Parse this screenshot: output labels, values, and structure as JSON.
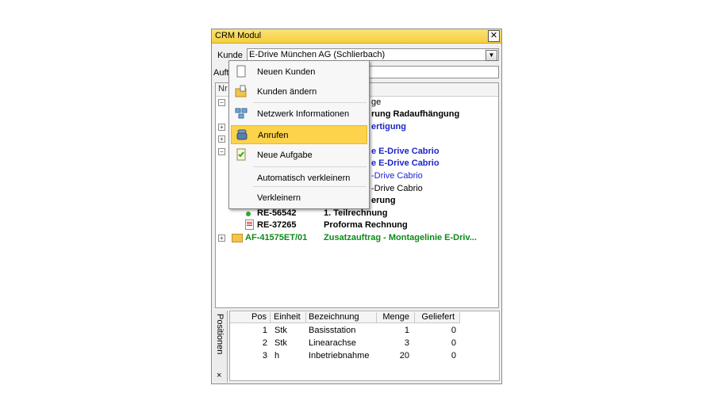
{
  "window": {
    "title": "CRM Modul",
    "close": "✕"
  },
  "kunde": {
    "label": "Kunde",
    "value": "E-Drive München AG  (Schlierbach)"
  },
  "auftrag": {
    "label": "Auft"
  },
  "tree": {
    "header": "Nr",
    "rows": [
      {
        "text": "ge"
      },
      {
        "text": "rung Radaufhängung"
      },
      {
        "text": "ertigung"
      },
      {
        "text": "e E-Drive Cabrio"
      },
      {
        "text": "e E-Drive Cabrio"
      },
      {
        "text": "-Drive Cabrio"
      },
      {
        "text": "-Drive Cabrio"
      },
      {
        "text": "erung"
      },
      {
        "nr": "RE-56542",
        "text": "1. Teilrechnung"
      },
      {
        "nr": "RE-37265",
        "text": "Proforma Rechnung"
      },
      {
        "nr": "AF-41575ET/01",
        "text": "Zusatzauftrag - Montagelinie E-Driv..."
      }
    ]
  },
  "menu": {
    "items": [
      {
        "label": "Neuen Kunden",
        "icon": "new-document-icon"
      },
      {
        "label": "Kunden ändern",
        "icon": "folder-edit-icon"
      },
      {
        "label": "Netzwerk Informationen",
        "icon": "network-icon"
      },
      {
        "label": "Anrufen",
        "icon": "phone-icon"
      },
      {
        "label": "Neue Aufgabe",
        "icon": "task-icon"
      },
      {
        "label": "Automatisch verkleinern",
        "icon": ""
      },
      {
        "label": "Verkleinern",
        "icon": ""
      }
    ]
  },
  "positionen": {
    "tab_label": "Positionen",
    "close": "×",
    "columns": [
      "Pos",
      "Einheit",
      "Bezeichnung",
      "Menge",
      "Geliefert"
    ],
    "rows": [
      [
        "1",
        "Stk",
        "Basisstation",
        "1",
        "0"
      ],
      [
        "2",
        "Stk",
        "Linearachse",
        "3",
        "0"
      ],
      [
        "3",
        "h",
        "Inbetriebnahme",
        "20",
        "0"
      ]
    ]
  },
  "colors": {
    "highlight": "#fcd34a",
    "title_bar": "#f5cf3c",
    "link_blue": "#1b26c9",
    "order_green": "#0d8a1a"
  }
}
